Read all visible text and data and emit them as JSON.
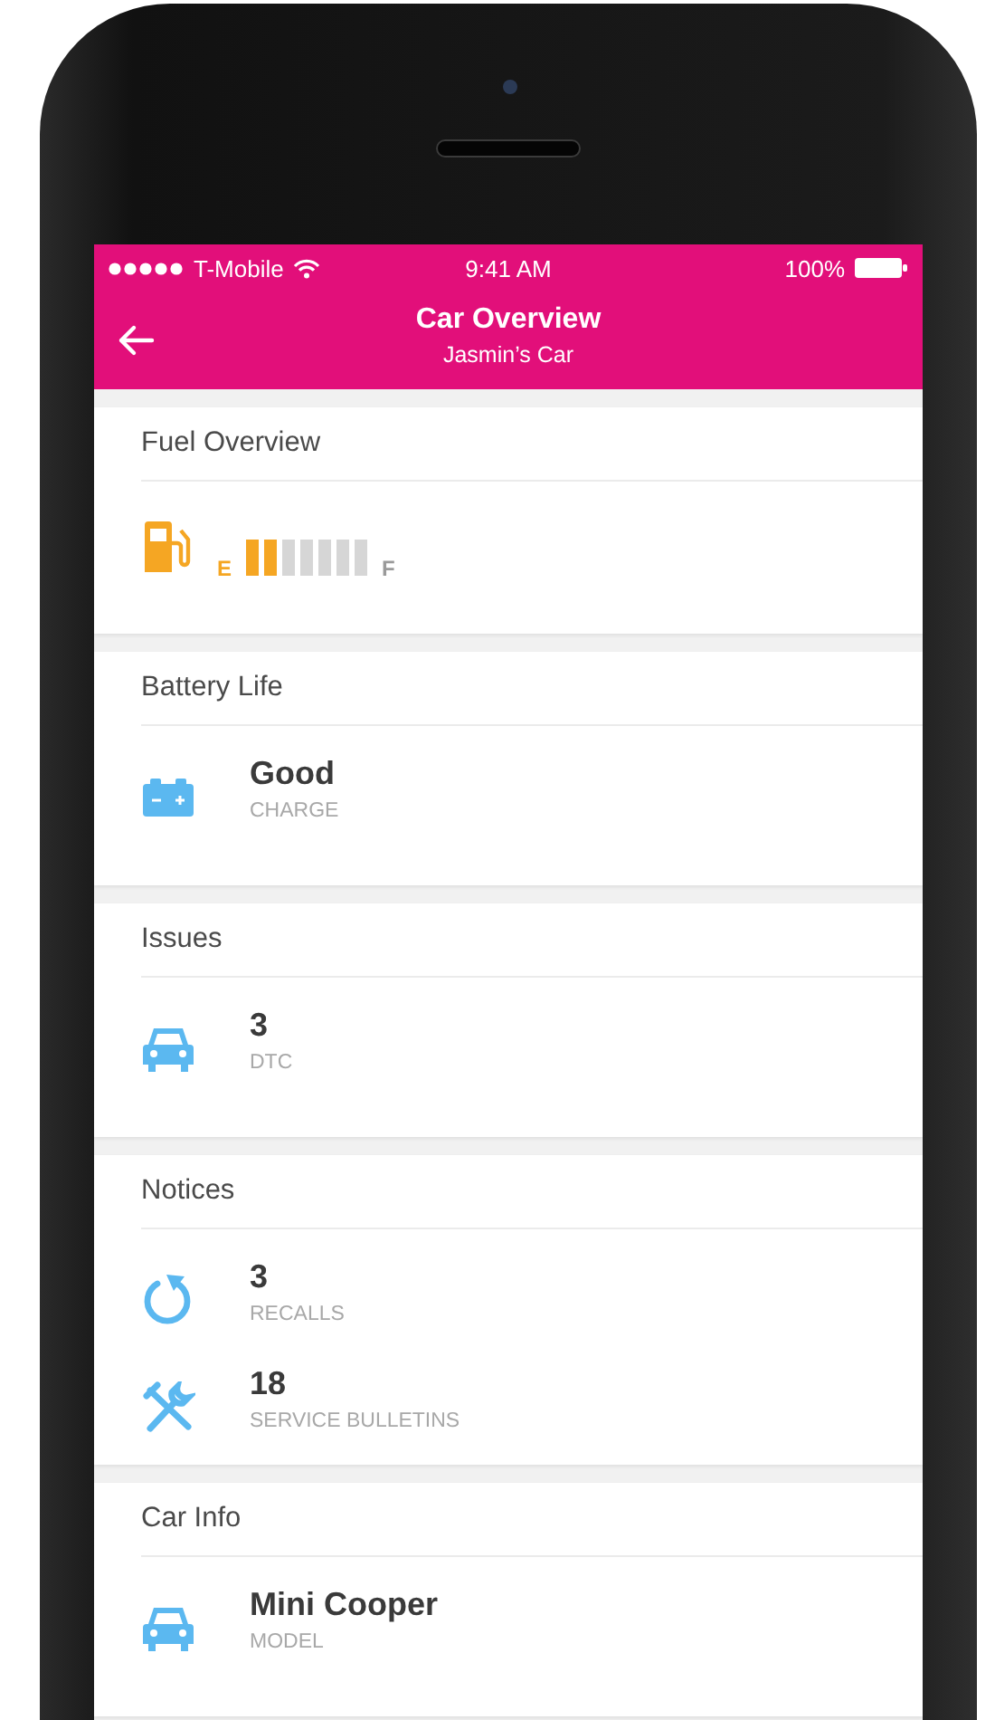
{
  "status_bar": {
    "carrier": "T-Mobile",
    "time": "9:41 AM",
    "battery": "100%"
  },
  "nav": {
    "title": "Car Overview",
    "subtitle": "Jasmin’s Car"
  },
  "sections": [
    {
      "title": "Fuel Overview",
      "kind": "fuel",
      "fuel": {
        "empty_label": "E",
        "full_label": "F",
        "level": 0.29
      }
    },
    {
      "title": "Battery Life",
      "kind": "stats",
      "items": [
        {
          "kind": "battery",
          "value": "Good",
          "label": "CHARGE"
        }
      ]
    },
    {
      "title": "Issues",
      "kind": "stats",
      "items": [
        {
          "kind": "car",
          "value": "3",
          "label": "DTC"
        }
      ]
    },
    {
      "title": "Notices",
      "kind": "stats",
      "items": [
        {
          "kind": "recall",
          "value": "3",
          "label": "RECALLS"
        },
        {
          "kind": "tools",
          "value": "18",
          "label": "SERVICE BULLETINS"
        }
      ]
    },
    {
      "title": "Car Info",
      "kind": "stats",
      "items": [
        {
          "kind": "car",
          "value": "Mini Cooper",
          "label": "MODEL"
        }
      ]
    }
  ]
}
